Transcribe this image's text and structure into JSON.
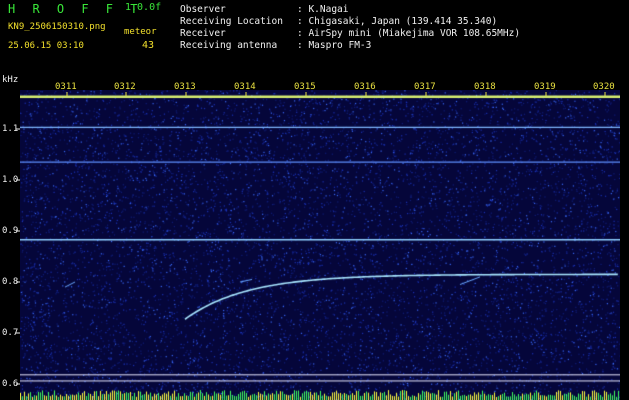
{
  "header": {
    "app_title": "H R O F F T",
    "version": "1.0.0f",
    "filename": "KN9_2506150310.png",
    "datetime": "25.06.15 03:10",
    "meteor_label": "meteor",
    "meteor_count": "43",
    "fields": [
      {
        "label": "Observer",
        "value": ": K.Nagai"
      },
      {
        "label": "Receiving Location",
        "value": ": Chigasaki, Japan (139.414 35.340)"
      },
      {
        "label": "Receiver",
        "value": ": AirSpy mini (Miakejima VOR 108.65MHz)"
      },
      {
        "label": "Receiving antenna",
        "value": ": Maspro FM-3"
      }
    ]
  },
  "chart_data": {
    "type": "heatmap",
    "ylabel": "kHz",
    "y_ticks": [
      "1.1",
      "1.0",
      "0.9",
      "0.8",
      "0.7",
      "0.6"
    ],
    "x_ticks": [
      "0311",
      "0312",
      "0313",
      "0314",
      "0315",
      "0316",
      "0317",
      "0318",
      "0319",
      "0320"
    ],
    "ylim": [
      0.6,
      1.18
    ],
    "colors": {
      "background": "#05063a",
      "noise": "#1e3ad8",
      "line": "#9fd8ff",
      "meteor": "#a8e6ff",
      "activity": "#ffff40"
    }
  }
}
